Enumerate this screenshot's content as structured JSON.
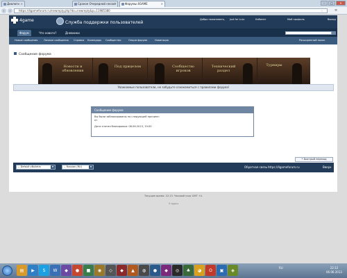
{
  "browser": {
    "tabs": [
      {
        "title": "Диалоги",
        "close": "×"
      },
      {
        "title": "Сраное Очередной несост",
        "close": "×"
      },
      {
        "title": "Форумы 4GAME",
        "close": "×"
      }
    ],
    "window_buttons": [
      "–",
      "□",
      "×"
    ],
    "url": "https://4gameforum.ru/newreply.php?do=newreply&p=11985380"
  },
  "site": {
    "logo": "4game",
    "subtitle": "Служба поддержки пользователей",
    "top_links": [
      "Добро пожаловать,",
      "Just for LuLs",
      "Мой профиль",
      "Выход"
    ],
    "top_links_mid": "Кабинет",
    "nav": [
      "Форум",
      "Что нового?",
      "Дневники"
    ],
    "subnav": [
      "Новые сообщения",
      "Личные сообщения",
      "Справка",
      "Календарь",
      "Сообщество",
      "Опции форума",
      "Навигация"
    ],
    "adv_search": "Расширенный поиск"
  },
  "breadcrumb": "Сообщение форума",
  "banner": {
    "items": [
      "Новости и обновления",
      "Под прицелом",
      "Сообщество игроков",
      "Технический раздел",
      "Турниры"
    ]
  },
  "notice": "Уважаемые пользователи, не забудьте ознакомиться с правилами форума!",
  "message": {
    "header": "Сообщение форума",
    "line1": "Вы были заблокированы по следующей причине:",
    "line2": "от",
    "line3": "Дата снятия блокировки: 08.06.2013, 19:00"
  },
  "quick_reply": "• Быстрый переход",
  "footer": {
    "style_select": "-- Default vBulletin",
    "lang_select": "-- Russian (RU)",
    "links": [
      "Обратная связь",
      "https://4gameforum.ru",
      "Вверх"
    ],
    "time_text": "Текущее время: 22:13. Часовой пояс GMT +4.",
    "copyright": "© 4game"
  },
  "taskbar": {
    "tray_lang": "RU",
    "clock_time": "22:12",
    "clock_date": "06.06.2013"
  }
}
